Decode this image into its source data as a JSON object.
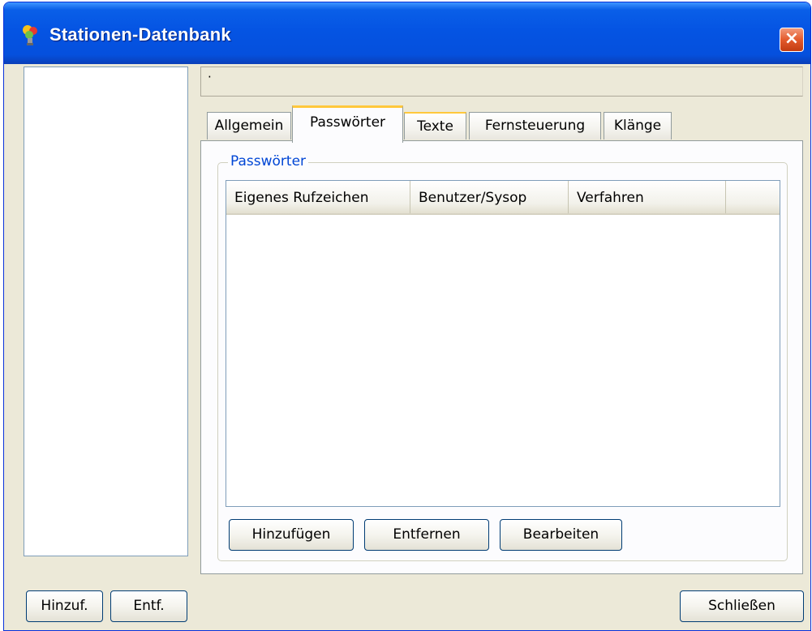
{
  "window": {
    "title": "Stationen-Datenbank"
  },
  "info_bar": {
    "text": "·"
  },
  "tabs": [
    {
      "label": "Allgemein"
    },
    {
      "label": "Passwörter"
    },
    {
      "label": "Texte"
    },
    {
      "label": "Fernsteuerung"
    },
    {
      "label": "Klänge"
    }
  ],
  "active_tab": "Passwörter",
  "passwords": {
    "group_title": "Passwörter",
    "columns": [
      "Eigenes Rufzeichen",
      "Benutzer/Sysop",
      "Verfahren"
    ],
    "rows": [],
    "add_label": "Hinzufügen",
    "remove_label": "Entfernen",
    "edit_label": "Bearbeiten"
  },
  "footer": {
    "add_label": "Hinzuf.",
    "remove_label": "Entf.",
    "close_label": "Schließen"
  },
  "colors": {
    "titlebar": "#0554e3",
    "close_button": "#e35a2c",
    "group_title": "#0046d5",
    "active_tab_accent": "#ffc83c"
  },
  "icons": {
    "app": "lightbulb-colored-icon",
    "close": "close-x-icon"
  }
}
